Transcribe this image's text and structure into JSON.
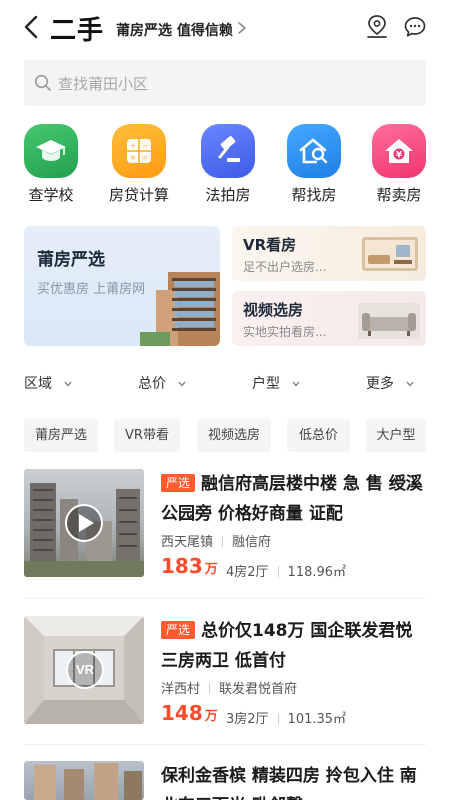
{
  "header": {
    "title": "二手",
    "slogan": "莆房严选 值得信赖"
  },
  "search": {
    "placeholder": "查找莆田小区"
  },
  "quick_actions": [
    {
      "label": "查学校",
      "icon": "graduation-cap-icon",
      "color": "#2fae5a"
    },
    {
      "label": "房贷计算",
      "icon": "calculator-icon",
      "color": "#ffa21f"
    },
    {
      "label": "法拍房",
      "icon": "gavel-icon",
      "color": "#4b6cf0"
    },
    {
      "label": "帮找房",
      "icon": "house-search-icon",
      "color": "#2e8ef0"
    },
    {
      "label": "帮卖房",
      "icon": "house-money-icon",
      "color": "#f5457e"
    }
  ],
  "promo": {
    "main": {
      "title": "莆房严选",
      "subtitle": "买优惠房 上莆房网"
    },
    "vr": {
      "title": "VR看房",
      "subtitle": "足不出户选房..."
    },
    "video": {
      "title": "视频选房",
      "subtitle": "实地实拍看房..."
    }
  },
  "filters": [
    "区域",
    "总价",
    "户型",
    "更多"
  ],
  "tags": [
    "莆房严选",
    "VR带看",
    "视频选房",
    "低总价",
    "大户型"
  ],
  "listings": [
    {
      "badge": "严选",
      "title": "融信府高层楼中楼 急 售 绶溪公园旁 价格好商量 证配",
      "area": "西天尾镇",
      "community": "融信府",
      "price": "183",
      "unit": "万",
      "layout": "4房2厅",
      "size": "118.96㎡",
      "media": "video"
    },
    {
      "badge": "严选",
      "title": "总价仅148万 国企联发君悦 三房两卫 低首付",
      "area": "洋西村",
      "community": "联发君悦首府",
      "price": "148",
      "unit": "万",
      "layout": "3房2厅",
      "size": "101.35㎡",
      "media": "vr",
      "media_label": "VR"
    },
    {
      "title": "保利金香槟 精装四房 拎包入住 南北东三面光 毗邻馨"
    }
  ],
  "colors": {
    "accent": "#ff4b2b",
    "badge": "#ff5b2e",
    "search_bg": "#f3f4f6"
  }
}
